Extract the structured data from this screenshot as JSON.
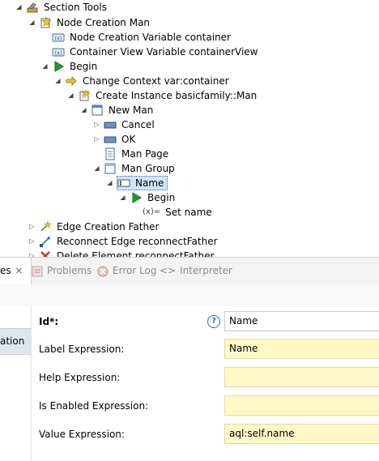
{
  "tree": {
    "section_tools": "Section Tools",
    "node_creation_man": "Node Creation Man",
    "node_creation_variable": "Node Creation Variable container",
    "container_view_variable": "Container View Variable containerView",
    "begin": "Begin",
    "change_context": "Change Context var:container",
    "create_instance": "Create Instance basicfamily::Man",
    "new_man": "New Man",
    "cancel": "Cancel",
    "ok": "OK",
    "man_page": "Man Page",
    "man_group": "Man Group",
    "name": "Name",
    "begin2": "Begin",
    "set_name_prefix": "(x)=",
    "set_name": "Set name",
    "edge_creation_father": "Edge Creation Father",
    "reconnect_edge": "Reconnect Edge reconnectFather",
    "delete_partial": "Delete Element reconnectFather"
  },
  "tabs": {
    "properties_partial": "es",
    "problems": "Problems",
    "error_log": "Error Log",
    "interpreter": "Interpreter"
  },
  "side": {
    "tab_partial": "ation"
  },
  "form": {
    "id_label": "Id*:",
    "id_value": "Name",
    "label_expr_label": "Label Expression:",
    "label_expr_value": "Name",
    "help_expr_label": "Help Expression:",
    "help_expr_value": "",
    "enabled_expr_label": "Is Enabled Expression:",
    "enabled_expr_value": "",
    "value_expr_label": "Value Expression:",
    "value_expr_value": "aql:self.name",
    "help_glyph": "?"
  },
  "colors": {
    "selection_bg": "#cde6fb",
    "expression_field_bg": "#fff8c6",
    "begin_green": "#1e9e2e",
    "help_blue": "#2a6fb8"
  }
}
